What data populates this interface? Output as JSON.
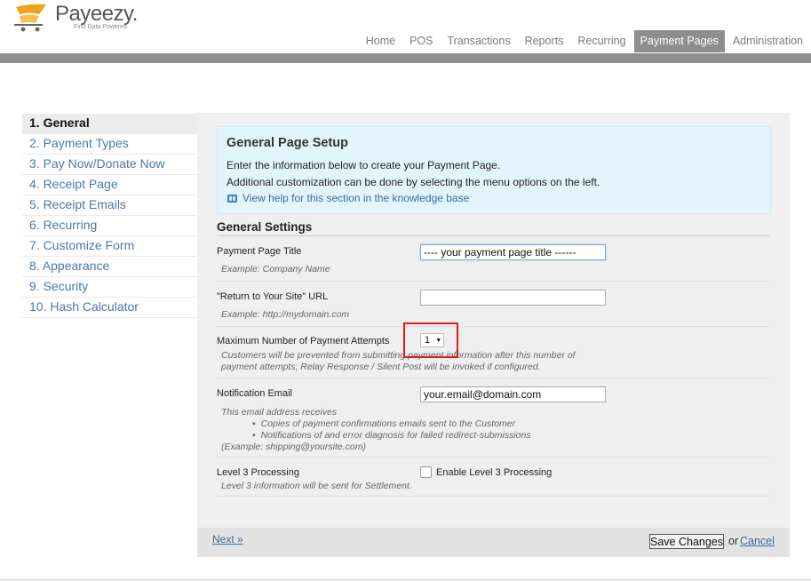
{
  "brand": {
    "name": "Payeezy.",
    "tagline": "First Data Powered",
    "color": "#555555",
    "accent": "#f0a21b"
  },
  "nav": {
    "items": [
      "Home",
      "POS",
      "Transactions",
      "Reports",
      "Recurring",
      "Payment Pages",
      "Administration"
    ],
    "active": "Payment Pages"
  },
  "sidebar": {
    "items": [
      "1. General",
      "2. Payment Types",
      "3. Pay Now/Donate Now",
      "4. Receipt Page",
      "5. Receipt Emails",
      "6. Recurring",
      "7. Customize Form",
      "8. Appearance",
      "9. Security",
      "10. Hash Calculator"
    ],
    "active": "1. General"
  },
  "info": {
    "title": "General Page Setup",
    "line1": "Enter the information below to create your Payment Page.",
    "line2": "Additional customization can be done by selecting the menu options on the left.",
    "help_link": "View help for this section in the knowledge base"
  },
  "settings": {
    "title": "General Settings",
    "payment_page_title": {
      "label": "Payment Page Title",
      "hint": "Example: Company Name",
      "value": "---- your payment page title ------"
    },
    "return_url": {
      "label": "\"Return to Your Site\" URL",
      "hint": "Example: http://mydomain.com",
      "value": ""
    },
    "max_attempts": {
      "label": "Maximum Number of Payment Attempts",
      "value": "1",
      "hint_line1": "Customers will be prevented from submitting payment information after this number of",
      "hint_line2": "payment attempts; Relay Response / Silent Post will be invoked if configured."
    },
    "notification_email": {
      "label": "Notification Email",
      "value": "your.email@domain.com",
      "hint_intro": "This email address receives",
      "bullet1": "Copies of payment confirmations emails sent to the Customer",
      "bullet2": "Notifications of and error diagnosis for failed redirect-submissions",
      "hint_example": "(Example: shipping@yoursite.com)"
    },
    "level3": {
      "label": "Level 3 Processing",
      "checkbox_label": "Enable Level 3 Processing",
      "hint": "Level 3 information will be sent for Settlement."
    }
  },
  "footer": {
    "next": "Next »",
    "save": "Save Changes",
    "or": "or",
    "cancel": "Cancel"
  }
}
